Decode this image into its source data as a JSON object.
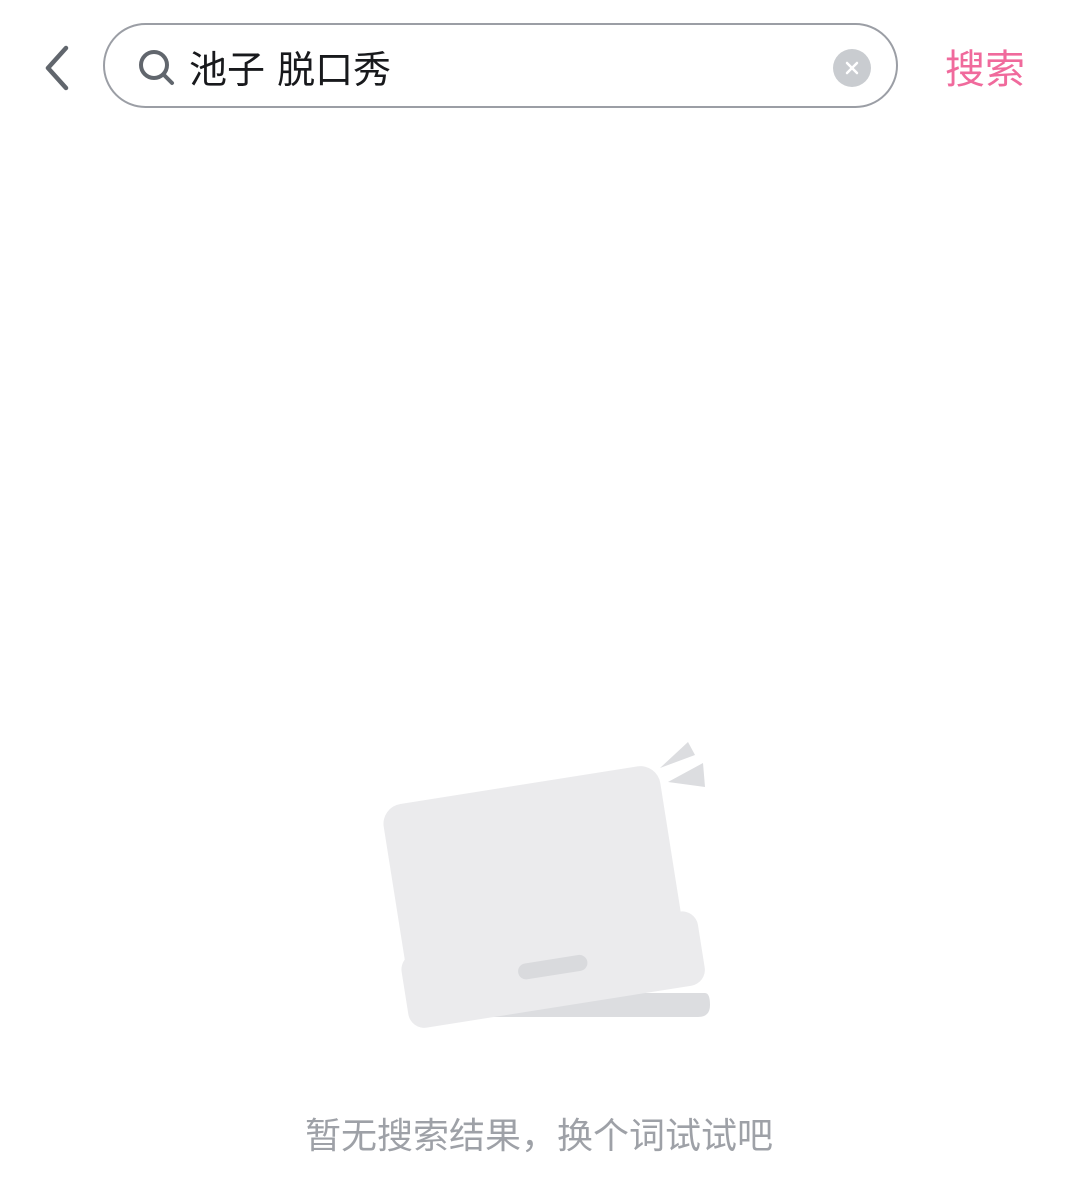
{
  "header": {
    "back_icon": "chevron-left-icon",
    "search": {
      "value": "池子 脱口秀",
      "placeholder": "",
      "search_icon": "search-icon",
      "clear_icon": "close-icon"
    },
    "submit_label": "搜索"
  },
  "empty_state": {
    "illustration": "tilted-laptop-icon",
    "message": "暂无搜索结果，换个词试试吧"
  },
  "colors": {
    "accent": "#f06a9c",
    "input_border": "#9b9ea5",
    "muted_text": "#9ea1a7",
    "illustration_fill": "#ebebed",
    "illustration_shadow": "#dcdde0"
  }
}
